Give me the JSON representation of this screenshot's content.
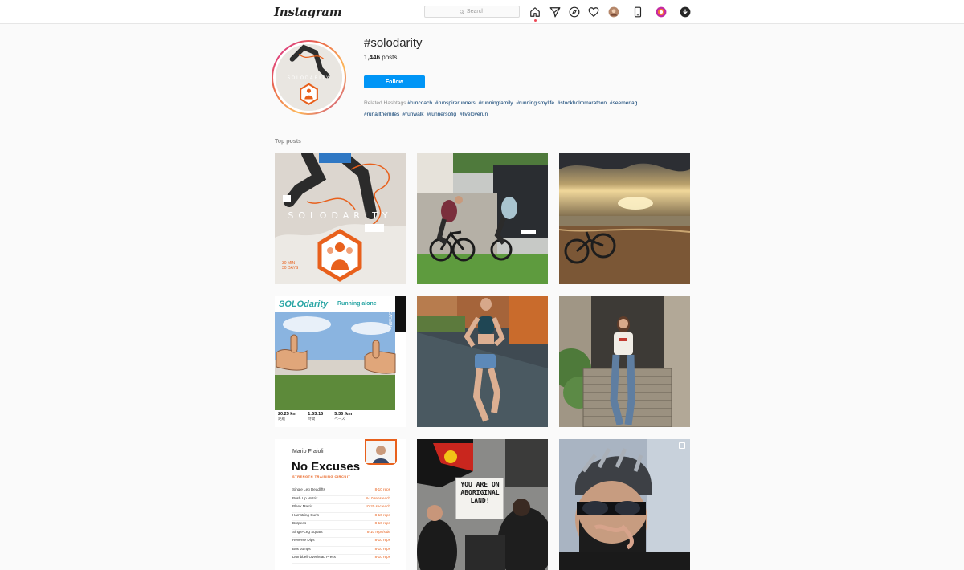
{
  "header": {
    "logo": "Instagram",
    "search_placeholder": "Search"
  },
  "hashtag": {
    "title": "#solodarity",
    "post_count": "1,446",
    "post_count_label": "posts",
    "follow_label": "Follow",
    "related_label": "Related Hashtags",
    "related": [
      "#runcoach",
      "#runspirerunners",
      "#runningfamily",
      "#runningismylife",
      "#stockholmmarathon",
      "#seemerlag",
      "#runallthemiles",
      "#runwalk",
      "#runnersofig",
      "#liveloverun"
    ]
  },
  "section": {
    "top_posts_label": "Top posts"
  },
  "posts": {
    "p1": {
      "brand": "SOLODARITY",
      "note1": "30 MIN",
      "note2": "30 DAYS"
    },
    "p4": {
      "title": "SOLOdarity",
      "subtitle": "Running alone",
      "side": "GARMIN",
      "stats": [
        {
          "value": "20.25 km",
          "label": "距離"
        },
        {
          "value": "1:53:15",
          "label": "時間"
        },
        {
          "value": "5:36 /km",
          "label": "ペース"
        }
      ]
    },
    "p7": {
      "name": "Mario Fraioli",
      "title": "No Excuses",
      "subtitle": "STRENGTH TRAINING CIRCUIT",
      "exercises": [
        {
          "name": "Single Leg Deadlifts",
          "reps": "8-10 reps"
        },
        {
          "name": "Push Up Matrix",
          "reps": "8-10 reps/each"
        },
        {
          "name": "Plank Matrix",
          "reps": "10-20 sec/each"
        },
        {
          "name": "Hamstring Curls",
          "reps": "8-10 reps"
        },
        {
          "name": "Burpees",
          "reps": "8-10 reps"
        },
        {
          "name": "Single-Leg Squats",
          "reps": "8-10 reps/side"
        },
        {
          "name": "Reverse Dips",
          "reps": "8-10 reps"
        },
        {
          "name": "Box Jumps",
          "reps": "8-10 reps"
        },
        {
          "name": "Dumbbell Overhead Press",
          "reps": "8-10 reps"
        }
      ]
    },
    "p8": {
      "sign": "YOU ARE ON ABORIGINAL LAND!"
    }
  },
  "colors": {
    "accent": "#0095f6",
    "link": "#00376b",
    "orange": "#e8601c"
  }
}
